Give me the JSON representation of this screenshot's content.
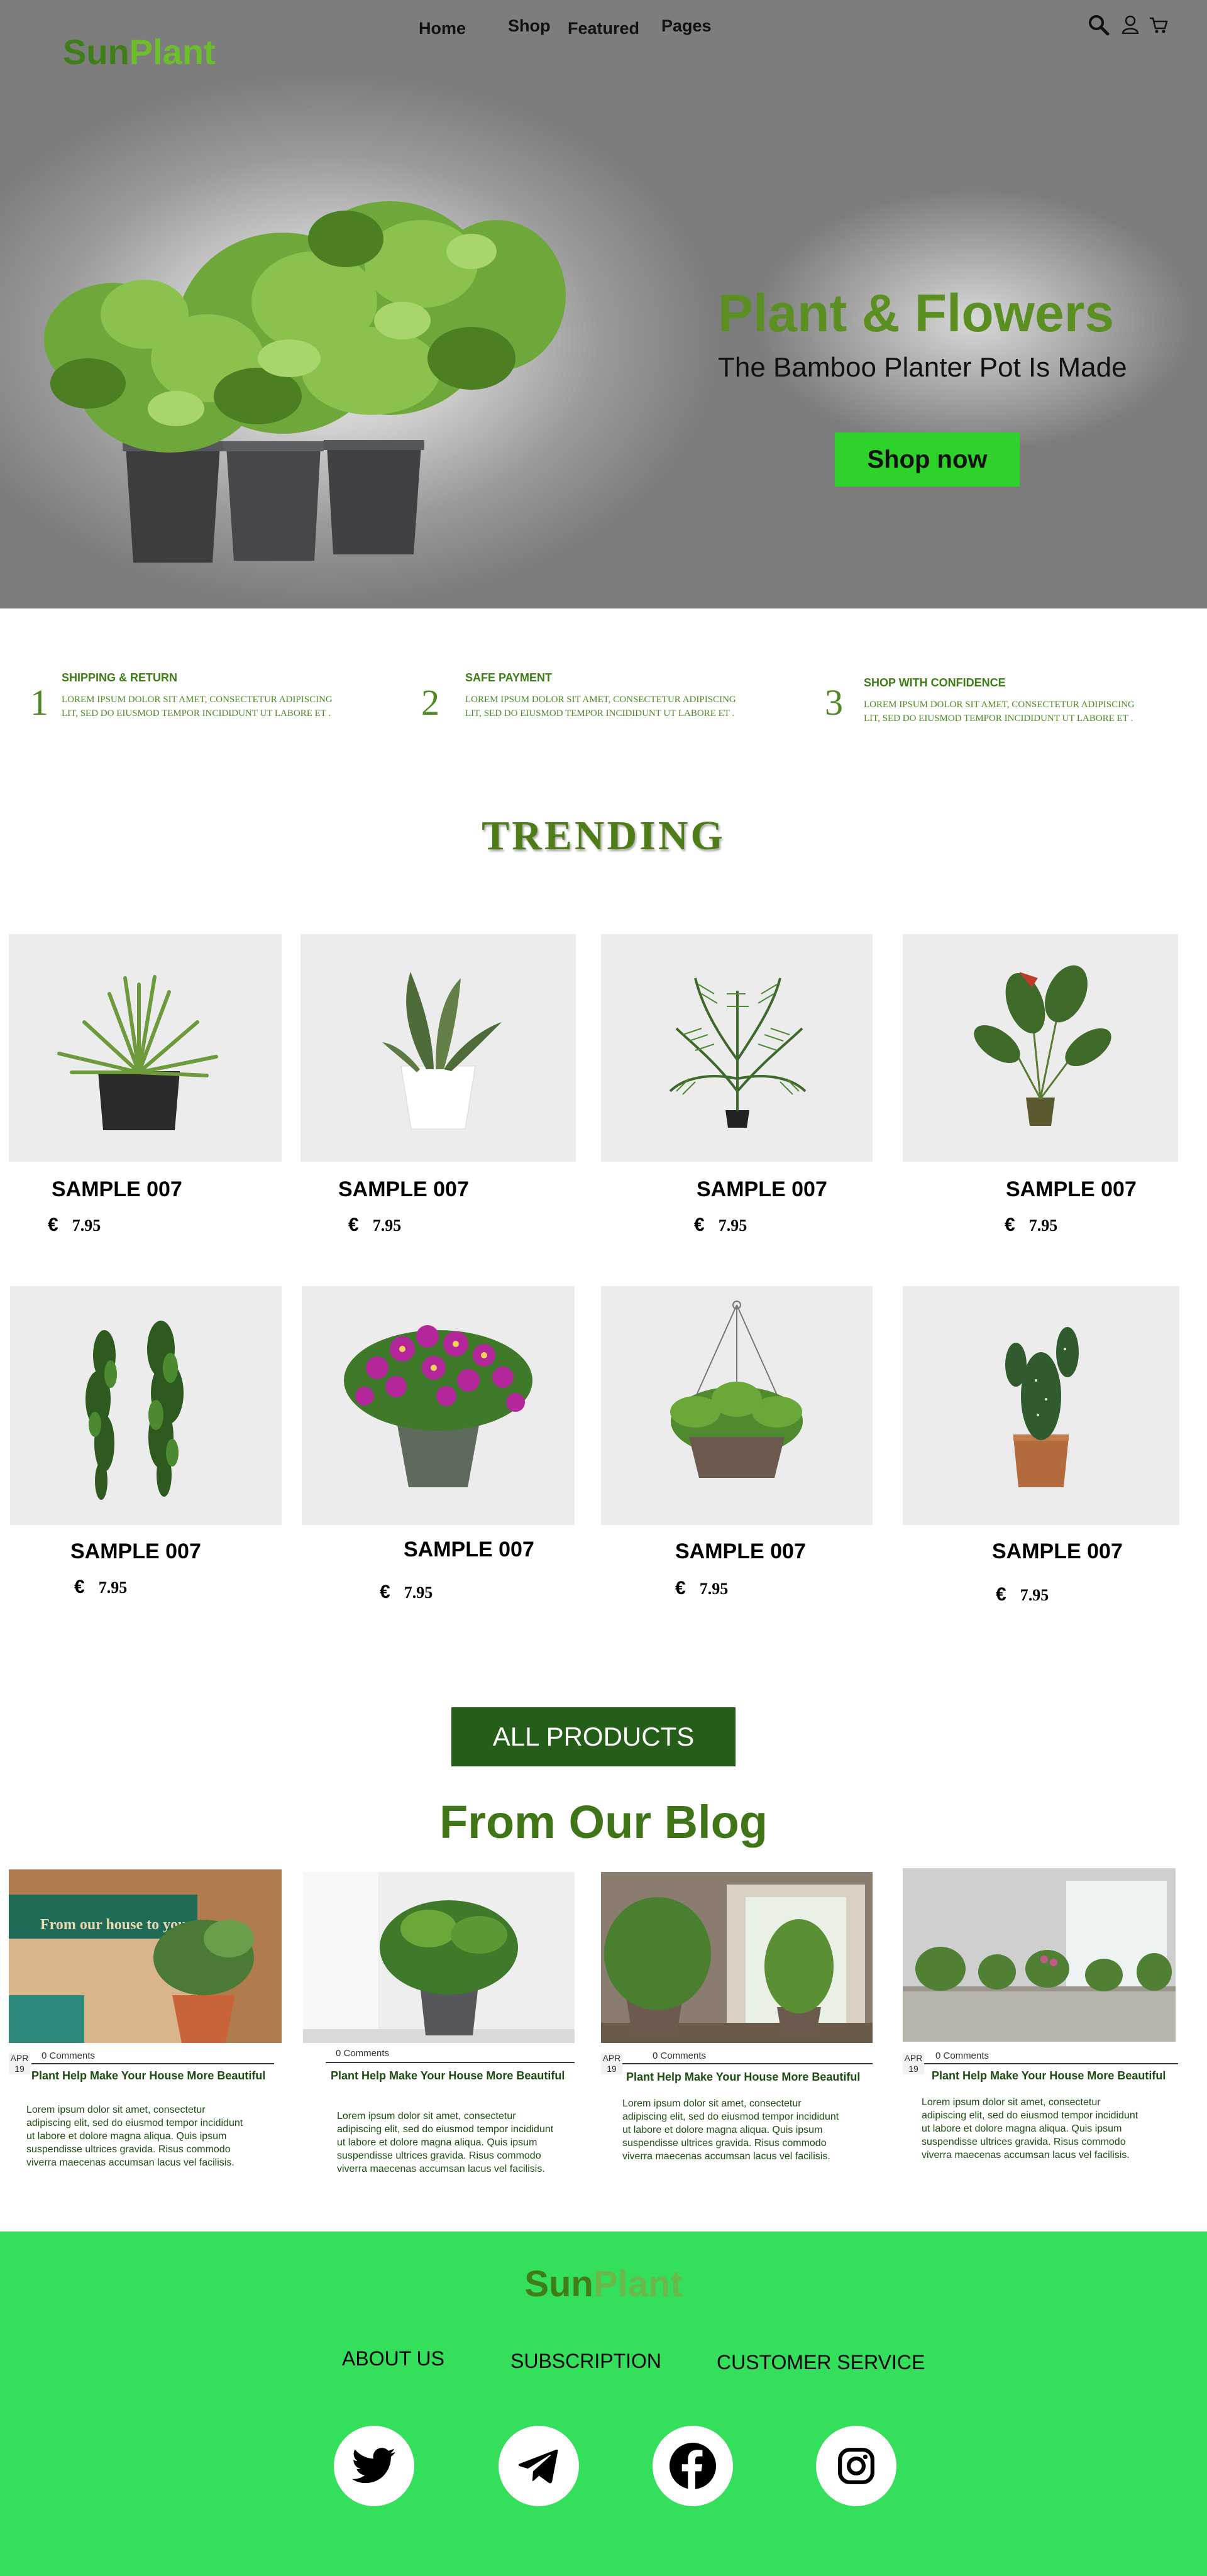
{
  "brand": {
    "logo_part1": "Sun",
    "logo_part2": "Plant"
  },
  "nav": {
    "home": "Home",
    "shop": "Shop",
    "featured": "Featured",
    "pages": "Pages",
    "icons": [
      "search-icon",
      "user-icon",
      "cart-icon"
    ]
  },
  "hero": {
    "title": "Plant & Flowers",
    "subtitle": "The Bamboo Planter Pot Is Made",
    "cta": "Shop now"
  },
  "features": [
    {
      "num": "1",
      "title": "SHIPPING &  RETURN",
      "line1": "LOREM IPSUM DOLOR SIT AMET, CONSECTETUR ADIPISCING",
      "line2": "LIT, SED DO EIUSMOD TEMPOR INCIDIDUNT UT LABORE ET ."
    },
    {
      "num": "2",
      "title": "SAFE PAYMENT",
      "line1": "LOREM IPSUM DOLOR SIT AMET, CONSECTETUR ADIPISCING",
      "line2": "LIT, SED DO EIUSMOD TEMPOR INCIDIDUNT UT LABORE ET ."
    },
    {
      "num": "3",
      "title": "SHOP WITH CONFIDENCE",
      "line1": "LOREM IPSUM DOLOR SIT AMET, CONSECTETUR ADIPISCING",
      "line2": "LIT, SED DO EIUSMOD TEMPOR INCIDIDUNT UT LABORE ET ."
    }
  ],
  "trending": {
    "title": "TRENDING",
    "products": [
      {
        "name": "SAMPLE 007",
        "currency": "€",
        "price": "7.95",
        "image": "spiky-plant-black-pot"
      },
      {
        "name": "SAMPLE 007",
        "currency": "€",
        "price": "7.95",
        "image": "snake-plant-white-pot"
      },
      {
        "name": "SAMPLE 007",
        "currency": "€",
        "price": "7.95",
        "image": "palm-plant"
      },
      {
        "name": "SAMPLE 007",
        "currency": "€",
        "price": "7.95",
        "image": "bird-of-paradise-plant"
      },
      {
        "name": "SAMPLE 007",
        "currency": "€",
        "price": "7.95",
        "image": "hanging-ivy-plants"
      },
      {
        "name": "SAMPLE 007",
        "currency": "€",
        "price": "7.95",
        "image": "purple-flowers-pot"
      },
      {
        "name": "SAMPLE 007",
        "currency": "€",
        "price": "7.95",
        "image": "hanging-basket-plant"
      },
      {
        "name": "SAMPLE 007",
        "currency": "€",
        "price": "7.95",
        "image": "cactus-copper-pot"
      }
    ]
  },
  "all_products": "ALL PRODUCTS",
  "blog": {
    "title": "From Our Blog",
    "posts": [
      {
        "month": "APR",
        "day": "19",
        "comments": "0 Comments",
        "heading": "Plant Help Make Your House More Beautiful",
        "body": [
          "Lorem ipsum dolor sit amet, consectetur",
          "adipiscing elit, sed do eiusmod tempor incididunt",
          "ut labore et dolore magna aliqua. Quis ipsum",
          "suspendisse ultrices gravida. Risus commodo",
          "viverra maecenas accumsan lacus vel facilisis."
        ],
        "image_text": "From our house to your"
      },
      {
        "month": "",
        "day": "",
        "comments": "0 Comments",
        "heading": "Plant Help Make Your House More Beautiful",
        "body": [
          "Lorem ipsum dolor sit amet, consectetur",
          "adipiscing elit, sed do eiusmod tempor incididunt",
          "ut labore et dolore magna aliqua. Quis ipsum",
          "suspendisse ultrices gravida. Risus commodo",
          "viverra maecenas accumsan lacus vel facilisis."
        ]
      },
      {
        "month": "APR",
        "day": "19",
        "comments": "0 Comments",
        "heading": "Plant Help Make Your House More Beautiful",
        "body": [
          "Lorem ipsum dolor sit amet, consectetur",
          "adipiscing elit, sed do eiusmod tempor incididunt",
          "ut labore et dolore magna aliqua. Quis ipsum",
          "suspendisse ultrices gravida. Risus commodo",
          "viverra maecenas accumsan lacus vel facilisis."
        ]
      },
      {
        "month": "APR",
        "day": "19",
        "comments": "0 Comments",
        "heading": "Plant Help Make Your House More Beautiful",
        "body": [
          "Lorem ipsum dolor sit amet, consectetur",
          "adipiscing elit, sed do eiusmod tempor incididunt",
          "ut labore et dolore magna aliqua. Quis ipsum",
          "suspendisse ultrices gravida. Risus commodo",
          "viverra maecenas accumsan lacus vel facilisis."
        ]
      }
    ]
  },
  "footer": {
    "logo_part1": "Sun",
    "logo_part2": "Plant",
    "links": [
      "ABOUT US",
      "SUBSCRIPTION",
      "CUSTOMER SERVICE"
    ],
    "social": [
      "twitter-icon",
      "telegram-icon",
      "facebook-icon",
      "instagram-icon"
    ]
  },
  "colors": {
    "brand_dark": "#3f7d17",
    "brand_light": "#6cbf2a",
    "cta": "#2fd12b",
    "all_products_btn": "#245e19",
    "footer_bg": "#33df5b"
  }
}
